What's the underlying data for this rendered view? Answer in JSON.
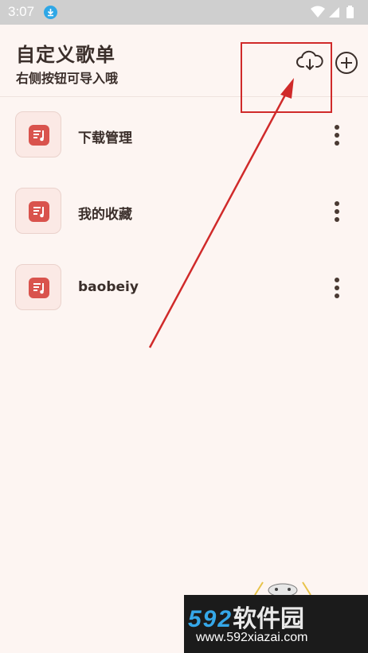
{
  "status_bar": {
    "time": "3:07"
  },
  "header": {
    "title": "自定义歌单",
    "subtitle": "右侧按钮可导入哦"
  },
  "playlists": [
    {
      "name": "下载管理"
    },
    {
      "name": "我的收藏"
    },
    {
      "name": "baobeiy"
    }
  ],
  "watermark": {
    "brand_num": "592",
    "brand_text": "软件园",
    "url": "www.592xiazai.com"
  },
  "colors": {
    "accent": "#d9534d",
    "annotation": "#d02a2a",
    "background": "#fdf5f2"
  }
}
